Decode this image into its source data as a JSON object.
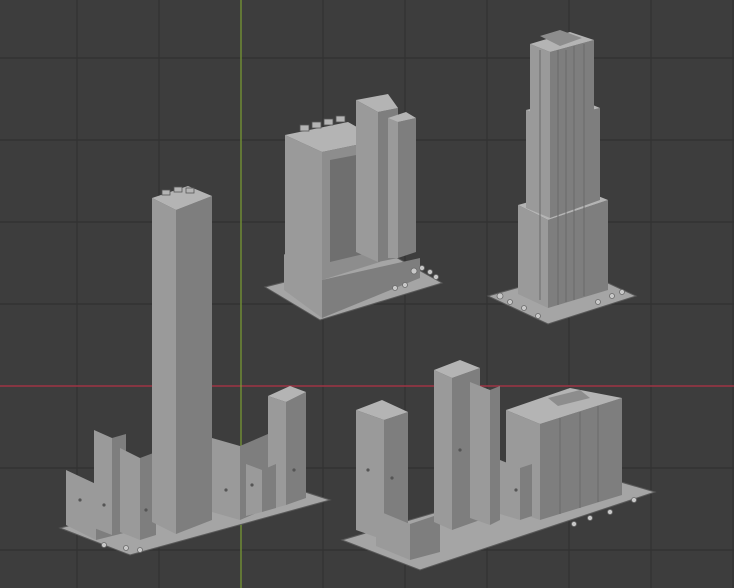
{
  "viewport": {
    "background": "#3d3d3d",
    "grid_color": "#333333",
    "axis_colors": {
      "x": "#b5374a",
      "y": "#7fa235"
    },
    "grid_visible": true
  },
  "models": [
    {
      "name": "tall-slab-tower-block"
    },
    {
      "name": "wide-office-tower"
    },
    {
      "name": "stepped-art-deco-tower"
    },
    {
      "name": "low-city-block"
    }
  ]
}
